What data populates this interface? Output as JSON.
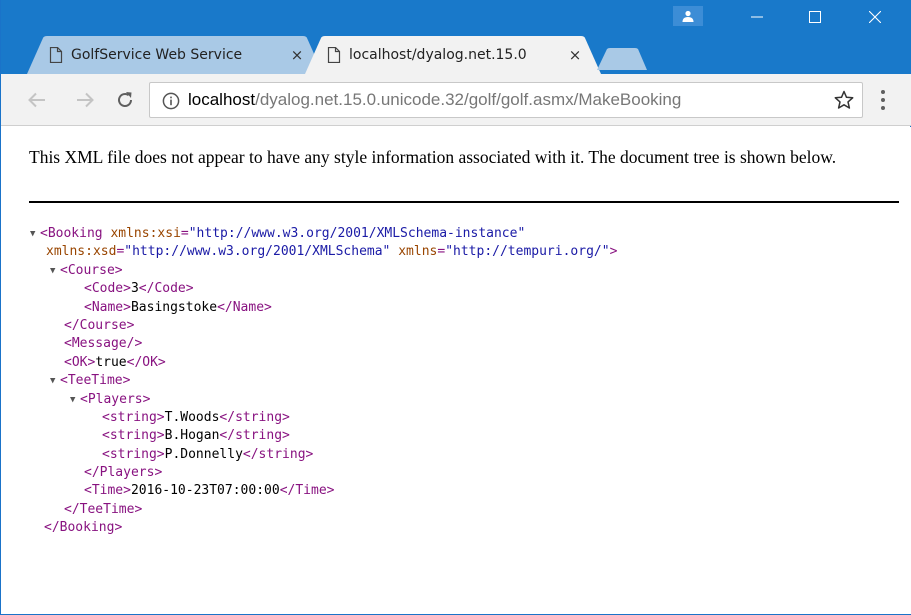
{
  "browser": {
    "tabs": [
      {
        "title": "GolfService Web Service",
        "active": false
      },
      {
        "title": "localhost/dyalog.net.15.0",
        "active": true
      }
    ],
    "tab_close_glyph": "×",
    "address": {
      "host": "localhost",
      "path": "/dyalog.net.15.0.unicode.32/golf/golf.asmx/MakeBooking"
    },
    "colors": {
      "titlebar": "#1979ca",
      "tag": "#881280",
      "attribute_name": "#994500",
      "attribute_value": "#1a1aa6"
    }
  },
  "page": {
    "notice": "This XML file does not appear to have any style information associated with it. The document tree is shown below."
  },
  "xml": {
    "booking_open": "<Booking",
    "xsi_name": "xmlns:xsi",
    "xsi_value": "\"http://www.w3.org/2001/XMLSchema-instance\"",
    "xsd_name": "xmlns:xsd",
    "xsd_value": "\"http://www.w3.org/2001/XMLSchema\"",
    "xmlns_name": "xmlns",
    "xmlns_value": "\"http://tempuri.org/\"",
    "course_open": "<Course>",
    "code_open": "<Code>",
    "code_value": "3",
    "code_close": "</Code>",
    "name_open": "<Name>",
    "name_value": "Basingstoke",
    "name_close": "</Name>",
    "course_close": "</Course>",
    "message": "<Message/>",
    "ok_open": "<OK>",
    "ok_value": "true",
    "ok_close": "</OK>",
    "teetime_open": "<TeeTime>",
    "players_open": "<Players>",
    "string_open": "<string>",
    "string_close": "</string>",
    "players": [
      "T.Woods",
      "B.Hogan",
      "P.Donnelly"
    ],
    "players_close": "</Players>",
    "time_open": "<Time>",
    "time_value": "2016-10-23T07:00:00",
    "time_close": "</Time>",
    "teetime_close": "</TeeTime>",
    "booking_close": "</Booking>"
  }
}
